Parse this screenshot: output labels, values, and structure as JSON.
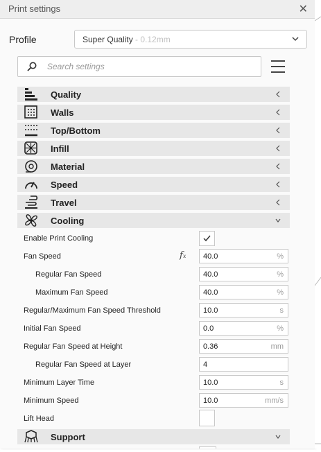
{
  "window": {
    "title": "Print settings",
    "close_icon": "close-icon"
  },
  "profile": {
    "label": "Profile",
    "value": "Super Quality",
    "detail": "- 0.12mm"
  },
  "search": {
    "placeholder": "Search settings",
    "value": ""
  },
  "categories": [
    {
      "label": "Quality",
      "icon": "quality-icon",
      "expanded": false
    },
    {
      "label": "Walls",
      "icon": "walls-icon",
      "expanded": false
    },
    {
      "label": "Top/Bottom",
      "icon": "top-bottom-icon",
      "expanded": false
    },
    {
      "label": "Infill",
      "icon": "infill-icon",
      "expanded": false
    },
    {
      "label": "Material",
      "icon": "material-icon",
      "expanded": false
    },
    {
      "label": "Speed",
      "icon": "speed-icon",
      "expanded": false
    },
    {
      "label": "Travel",
      "icon": "travel-icon",
      "expanded": false
    },
    {
      "label": "Cooling",
      "icon": "cooling-icon",
      "expanded": true
    },
    {
      "label": "Support",
      "icon": "support-icon",
      "expanded": true
    }
  ],
  "cooling": {
    "enable_print_cooling": {
      "label": "Enable Print Cooling",
      "checked": true
    },
    "fan_speed": {
      "label": "Fan Speed",
      "value": "40.0",
      "unit": "%",
      "fx_symbol": "fx"
    },
    "regular_fan_speed": {
      "label": "Regular Fan Speed",
      "value": "40.0",
      "unit": "%"
    },
    "maximum_fan_speed": {
      "label": "Maximum Fan Speed",
      "value": "40.0",
      "unit": "%"
    },
    "fan_speed_threshold": {
      "label": "Regular/Maximum Fan Speed Threshold",
      "value": "10.0",
      "unit": "s"
    },
    "initial_fan_speed": {
      "label": "Initial Fan Speed",
      "value": "0.0",
      "unit": "%"
    },
    "fan_speed_at_height": {
      "label": "Regular Fan Speed at Height",
      "value": "0.36",
      "unit": "mm"
    },
    "fan_speed_at_layer": {
      "label": "Regular Fan Speed at Layer",
      "value": "4",
      "unit": ""
    },
    "minimum_layer_time": {
      "label": "Minimum Layer Time",
      "value": "10.0",
      "unit": "s"
    },
    "minimum_speed": {
      "label": "Minimum Speed",
      "value": "10.0",
      "unit": "mm/s"
    },
    "lift_head": {
      "label": "Lift Head",
      "checked": false
    }
  },
  "colors": {
    "category_bg": "#e7e7e7",
    "panel_bg": "#fafafa",
    "field_border": "#c8c8c8"
  }
}
